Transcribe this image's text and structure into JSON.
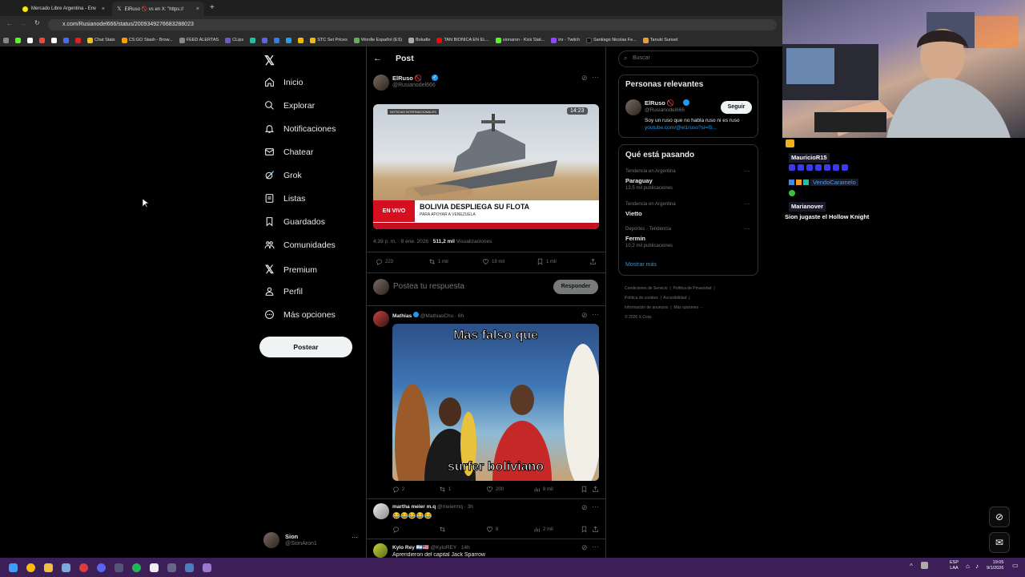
{
  "browser": {
    "tabs": [
      {
        "label": "Mercado Libre Argentina - Env",
        "color": "#ffe600"
      },
      {
        "label": "ElRuso 🚫 vs en X: \"https://",
        "color": "#ffffff"
      }
    ],
    "url": "x.com/Rusianodel666/status/2009349276683288023",
    "bookmarks": [
      "Chat Stats",
      "CS:GO Stash - Brow...",
      "FEED ALERTAS",
      "CLips",
      "STC Set Prices",
      "Wordle Español (ES)",
      "Boludle",
      "TAN BIONICA EN EL...",
      "sionaron - Kick Stat...",
      "tnr - Twitch",
      "Santiago Nicolas Fe...",
      "Tanuki Sunset"
    ]
  },
  "sidebar": {
    "items": [
      {
        "label": "Inicio"
      },
      {
        "label": "Explorar"
      },
      {
        "label": "Notificaciones"
      },
      {
        "label": "Chatear"
      },
      {
        "label": "Grok"
      },
      {
        "label": "Listas"
      },
      {
        "label": "Guardados"
      },
      {
        "label": "Comunidades"
      },
      {
        "label": "Premium"
      },
      {
        "label": "Perfil"
      },
      {
        "label": "Más opciones"
      }
    ],
    "post_label": "Postear",
    "account": {
      "name": "Sion",
      "handle": "@SionAron1"
    }
  },
  "main": {
    "header": "Post",
    "tweet": {
      "name": "ElRuso 🚫",
      "handle": "@Rusianodel666",
      "video": {
        "tag": "NOTICIAS INTERNACIONALES",
        "time": "14:23",
        "live": "EN VIVO",
        "headline": "BOLIVIA DESPLIEGA SU FLOTA",
        "sub": "PARA APOYAR A VENEZUELA"
      },
      "meta_time": "4:39 p. m. · 8 ene. 2026 · ",
      "views": "511,2 mil",
      "views_label": "Visualizaciones",
      "stats": {
        "replies": "223",
        "reposts": "1 mil",
        "likes": "19 mil",
        "bookmarks": "1 mil"
      }
    },
    "reply_placeholder": "Postea tu respuesta",
    "reply_button": "Responder",
    "replies": [
      {
        "name": "Mathias",
        "handle": "@MathiasChu · 6h",
        "meme_top": "Mas falso que",
        "meme_bottom": "surfer boliviano",
        "stats": {
          "replies": "2",
          "reposts": "1",
          "likes": "200",
          "views": "8 mil"
        }
      },
      {
        "name": "martha meier m.q",
        "handle": "@meiermq · 3h",
        "text": "😂😂😂😂😂",
        "stats": {
          "likes": "8",
          "views": "2 mil"
        }
      },
      {
        "name": "Kylo Rey 🇦🇷🇺🇸",
        "handle": "@KyloREY · 14h",
        "text": "Aprendieron del capital Jack Sparrow"
      }
    ]
  },
  "right": {
    "search_placeholder": "Buscar",
    "relevant": {
      "title": "Personas relevantes",
      "name": "ElRuso 🚫",
      "handle": "@Rusianodel666",
      "follow": "Seguir",
      "bio": "Soy un ruso que no habla ruso ni es ruso",
      "link": "youtube.com/@el1ruso?si=I5..."
    },
    "trending": {
      "title": "Qué está pasando",
      "items": [
        {
          "context": "Tendencia en Argentina",
          "topic": "Paraguay",
          "count": "13,5 mil publicaciones"
        },
        {
          "context": "Tendencia en Argentina",
          "topic": "Vietto",
          "count": ""
        },
        {
          "context": "Deportes · Tendencia",
          "topic": "Fermin",
          "count": "10,2 mil publicaciones"
        }
      ],
      "more": "Mostrar más"
    },
    "footer": [
      "Condiciones de Servicio",
      "Política de Privacidad",
      "Política de cookies",
      "Accesibilidad",
      "Información de anuncios",
      "Más opciones ···",
      "© 2026 X Corp."
    ]
  },
  "stream_chat": [
    {
      "user": "MauricioR15",
      "msg": ""
    },
    {
      "user": "VendoCaramelo",
      "msg": ""
    },
    {
      "user": "Marianover",
      "msg": "Sion jugaste el Hollow Knight"
    }
  ],
  "taskbar": {
    "lang": "ESP",
    "lang2": "LAA",
    "time": "19:05",
    "date": "9/1/2026"
  }
}
